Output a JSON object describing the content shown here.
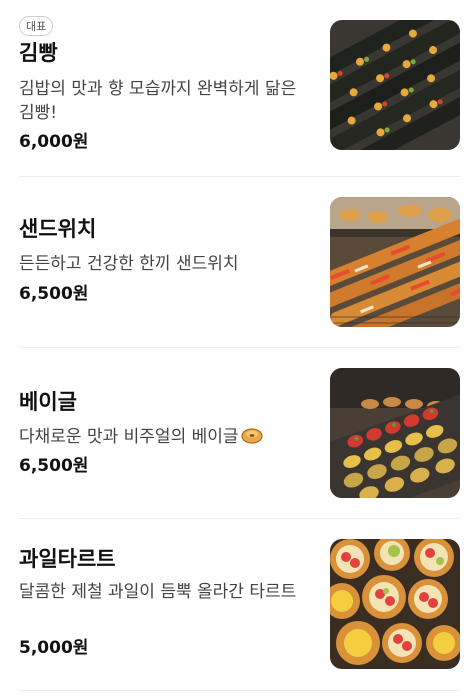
{
  "menu": {
    "items": [
      {
        "badge": "대표",
        "name": "김빵",
        "description": "김밥의 맛과 향 모습까지 완벽하게 닮은 김빵!",
        "price": "6,000원",
        "image": "kimbap-bread-photo"
      },
      {
        "name": "샌드위치",
        "description": "든든하고 건강한 한끼 샌드위치",
        "price": "6,500원",
        "image": "sandwich-display-photo"
      },
      {
        "name": "베이글",
        "description": "다채로운 맛과 비주얼의 베이글",
        "description_icon": "bagel-icon",
        "price": "6,500원",
        "image": "bagel-display-photo"
      },
      {
        "name": "과일타르트",
        "description": "달콤한 제철 과일이 듬뿍 올라간 타르트",
        "price": "5,000원",
        "image": "fruit-tart-photo"
      }
    ]
  }
}
